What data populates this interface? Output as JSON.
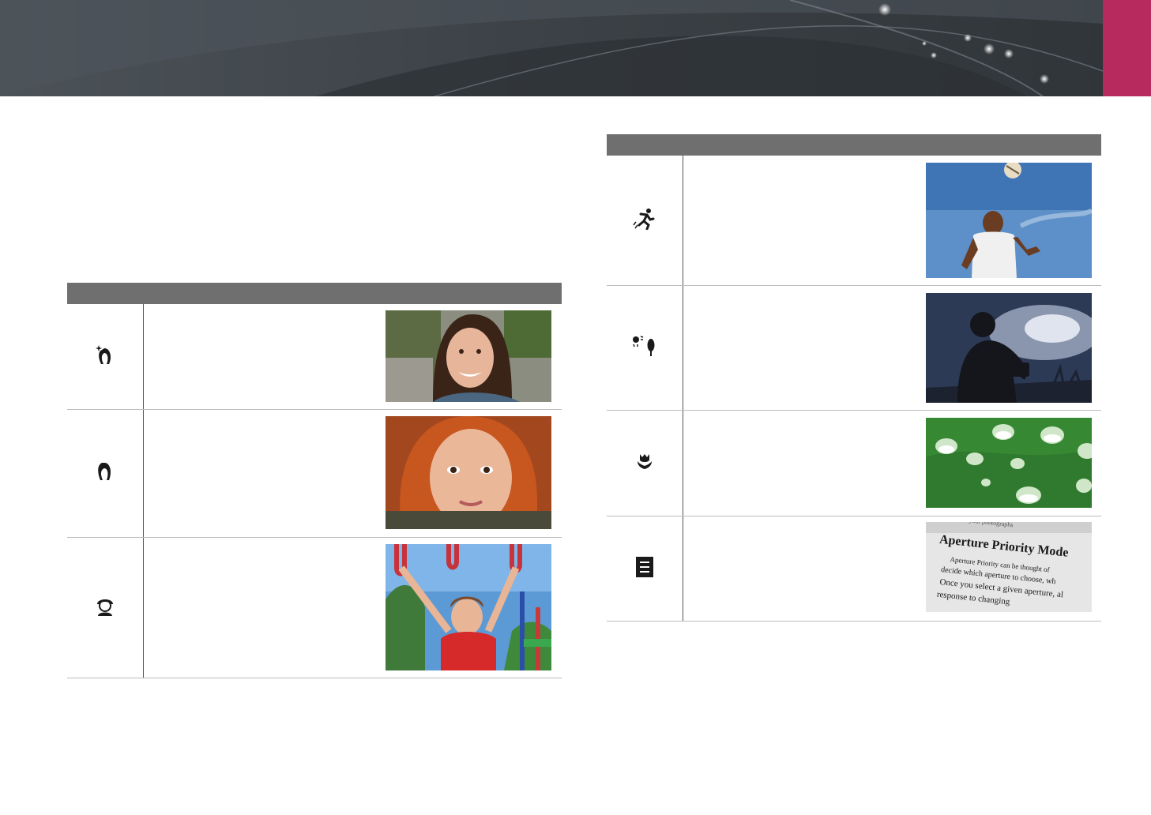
{
  "banner": {
    "accent_color": "#b72a5e",
    "background_color": "#3c4247"
  },
  "left_table": {
    "header_color": "#6f6f6f",
    "rows": [
      {
        "icon": "beauty-face-icon",
        "photo": "smiling-woman-portrait"
      },
      {
        "icon": "portrait-icon",
        "photo": "red-haired-girl-portrait"
      },
      {
        "icon": "children-icon",
        "photo": "child-on-playground"
      }
    ]
  },
  "right_table": {
    "header_color": "#6f6f6f",
    "rows": [
      {
        "icon": "sports-icon",
        "photo": "man-heading-football"
      },
      {
        "icon": "backlight-icon",
        "photo": "silhouette-photographer"
      },
      {
        "icon": "macro-flower-icon",
        "photo": "water-drops-on-leaf"
      },
      {
        "icon": "text-document-icon",
        "photo": "aperture-priority-mode-book-page",
        "photo_text": [
          "Aperture Priority Mode",
          "Aperture Priority can be thought of",
          "decide which aperture to choose, wh",
          "Once you select a given aperture, al",
          "response to changing",
          "of your photographs"
        ]
      }
    ]
  }
}
